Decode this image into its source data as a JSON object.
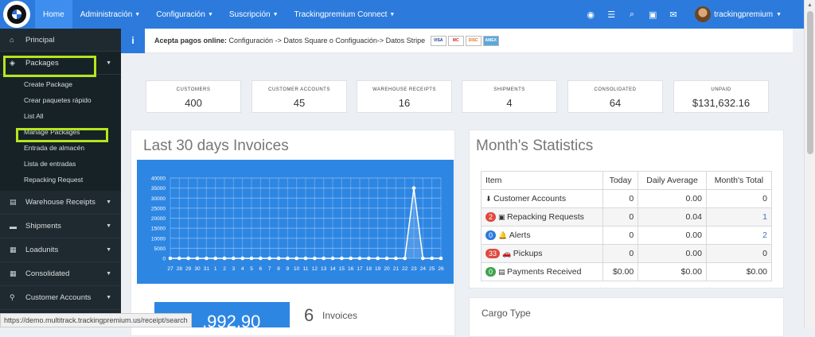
{
  "topbar": {
    "nav": [
      {
        "label": "Home",
        "caret": false
      },
      {
        "label": "Administración",
        "caret": true
      },
      {
        "label": "Configuración",
        "caret": true
      },
      {
        "label": "Suscripción",
        "caret": true
      },
      {
        "label": "Trackingpremium Connect",
        "caret": true
      }
    ],
    "icons": [
      "globe-icon",
      "list-icon",
      "search-icon",
      "money-icon",
      "envelope-icon"
    ],
    "user": "trackingpremium"
  },
  "sidebar": {
    "principal": "Principal",
    "packages": "Packages",
    "packages_sub": [
      "Create Package",
      "Crear paquetes rápido",
      "List All",
      "Manage Packages",
      "Entrada de almacén",
      "Lista de entradas",
      "Repacking Request"
    ],
    "items": [
      "Warehouse Receipts",
      "Shipments",
      "Loadunits",
      "Consolidated",
      "Customer Accounts"
    ]
  },
  "info": {
    "bold": "Acepta pagos online:",
    "text": "Configuración -> Datos Square o Configuación-> Datos Stripe",
    "cards": [
      "VISA",
      "MC",
      "DISC",
      "AMEX"
    ]
  },
  "stats": [
    {
      "label": "CUSTOMERS",
      "value": "400"
    },
    {
      "label": "CUSTOMER ACCOUNTS",
      "value": "45"
    },
    {
      "label": "WAREHOUSE RECEIPTS",
      "value": "16"
    },
    {
      "label": "SHIPMENTS",
      "value": "4"
    },
    {
      "label": "CONSOLIDATED",
      "value": "64"
    },
    {
      "label": "UNPAID",
      "value": "$131,632.16"
    }
  ],
  "invoices_panel": {
    "title": "Last 30 days Invoices",
    "total": ",992.90",
    "count": "6",
    "count_label": "Invoices"
  },
  "chart_data": {
    "type": "line",
    "categories": [
      "27",
      "28",
      "29",
      "30",
      "31",
      "1",
      "2",
      "3",
      "4",
      "5",
      "6",
      "7",
      "8",
      "9",
      "10",
      "11",
      "12",
      "13",
      "14",
      "15",
      "16",
      "17",
      "18",
      "19",
      "20",
      "21",
      "22",
      "23",
      "24",
      "25",
      "26"
    ],
    "values": [
      0,
      0,
      0,
      0,
      0,
      0,
      0,
      0,
      0,
      0,
      0,
      0,
      0,
      0,
      0,
      0,
      0,
      0,
      0,
      0,
      0,
      0,
      0,
      0,
      0,
      0,
      0,
      35000,
      0,
      0,
      0
    ],
    "yticks": [
      "40000",
      "35000",
      "30000",
      "25000",
      "20000",
      "15000",
      "10000",
      "5000",
      "0"
    ],
    "ylim": [
      0,
      40000
    ]
  },
  "month_panel": {
    "title": "Month's Statistics",
    "headers": [
      "Item",
      "Today",
      "Daily Average",
      "Month's Total"
    ],
    "rows": [
      {
        "badge": "",
        "badge_color": "",
        "icon": "download-icon",
        "iconchar": "⬇",
        "label": "Customer Accounts",
        "today": "0",
        "avg": "0.00",
        "total": "0",
        "link": false
      },
      {
        "badge": "2",
        "badge_color": "#e0483e",
        "icon": "repack-icon",
        "iconchar": "▣",
        "label": "Repacking Requests",
        "today": "0",
        "avg": "0.04",
        "total": "1",
        "link": true
      },
      {
        "badge": "0",
        "badge_color": "#2c7bdc",
        "icon": "bell-icon",
        "iconchar": "🔔",
        "label": "Alerts",
        "today": "0",
        "avg": "0.00",
        "total": "2",
        "link": true
      },
      {
        "badge": "33",
        "badge_color": "#e0483e",
        "icon": "car-icon",
        "iconchar": "🚗",
        "label": "Pickups",
        "today": "0",
        "avg": "0.00",
        "total": "0",
        "link": false
      },
      {
        "badge": "0",
        "badge_color": "#3fa34d",
        "icon": "money-icon",
        "iconchar": "▤",
        "label": "Payments Received",
        "today": "$0.00",
        "avg": "$0.00",
        "total": "$0.00",
        "link": false
      }
    ]
  },
  "cargo_panel": {
    "title": "Cargo Type"
  },
  "statusbar": "https://demo.multitrack.trackingpremium.us/receipt/search"
}
